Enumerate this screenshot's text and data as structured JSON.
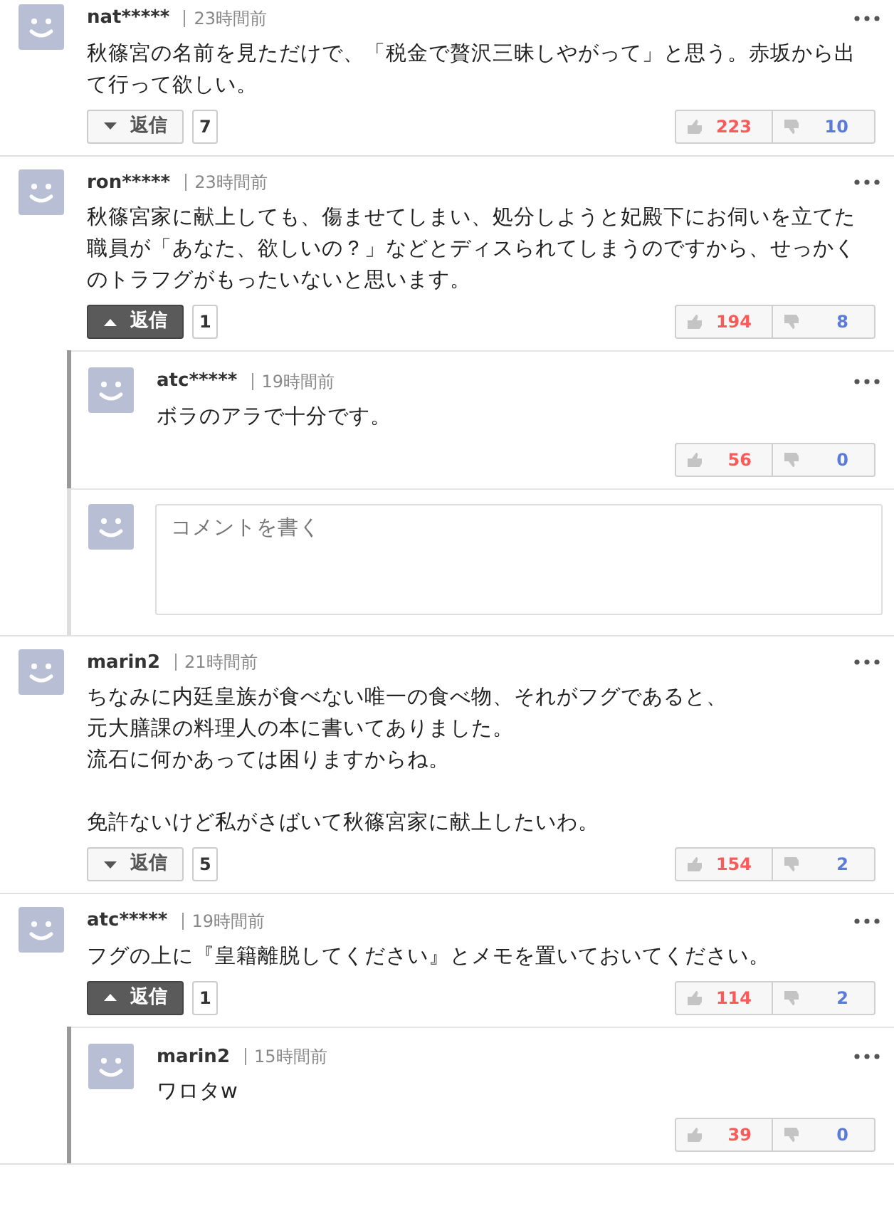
{
  "comments": [
    {
      "user": "nat*****",
      "time": "23時間前",
      "paragraphs": [
        [
          "秋篠宮の名前を見ただけで、「税金で贅沢三昧しやがって」と思う。赤坂から出",
          "て行って欲しい。"
        ]
      ],
      "reply": {
        "label": "返信",
        "expanded": false,
        "count": "7"
      },
      "likes": "223",
      "dislikes": "10"
    },
    {
      "user": "ron*****",
      "time": "23時間前",
      "paragraphs": [
        [
          "秋篠宮家に献上しても、傷ませてしまい、処分しようと妃殿下にお伺いを立てた",
          "職員が「あなた、欲しいの？」などとディスられてしまうのですから、せっかく",
          "のトラフグがもったいないと思います。"
        ]
      ],
      "reply": {
        "label": "返信",
        "expanded": true,
        "count": "1"
      },
      "likes": "194",
      "dislikes": "8",
      "replies": [
        {
          "user": "atc*****",
          "time": "19時間前",
          "lines": [
            "ボラのアラで十分です。"
          ],
          "likes": "56",
          "dislikes": "0"
        }
      ],
      "compose": {
        "placeholder": "コメントを書く"
      }
    },
    {
      "user": "marin2",
      "time": "21時間前",
      "paragraphs": [
        [
          "ちなみに内廷皇族が食べない唯一の食べ物、それがフグであると、",
          "元大膳課の料理人の本に書いてありました。",
          "流石に何かあっては困りますからね。"
        ],
        [
          "免許ないけど私がさばいて秋篠宮家に献上したいわ。"
        ]
      ],
      "reply": {
        "label": "返信",
        "expanded": false,
        "count": "5"
      },
      "likes": "154",
      "dislikes": "2"
    },
    {
      "user": "atc*****",
      "time": "19時間前",
      "paragraphs": [
        [
          "フグの上に『皇籍離脱してください』とメモを置いておいてください。"
        ]
      ],
      "reply": {
        "label": "返信",
        "expanded": true,
        "count": "1"
      },
      "likes": "114",
      "dislikes": "2",
      "replies": [
        {
          "user": "marin2",
          "time": "15時間前",
          "lines": [
            "ワロタw"
          ],
          "likes": "39",
          "dislikes": "0"
        }
      ]
    }
  ]
}
